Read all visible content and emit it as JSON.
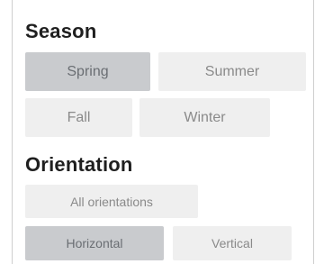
{
  "season": {
    "title": "Season",
    "options": [
      {
        "label": "Spring",
        "selected": true
      },
      {
        "label": "Summer",
        "selected": false
      },
      {
        "label": "Fall",
        "selected": false
      },
      {
        "label": "Winter",
        "selected": false
      }
    ]
  },
  "orientation": {
    "title": "Orientation",
    "options": [
      {
        "label": "All orientations",
        "selected": false
      },
      {
        "label": "Horizontal",
        "selected": true
      },
      {
        "label": "Vertical",
        "selected": false
      }
    ]
  }
}
